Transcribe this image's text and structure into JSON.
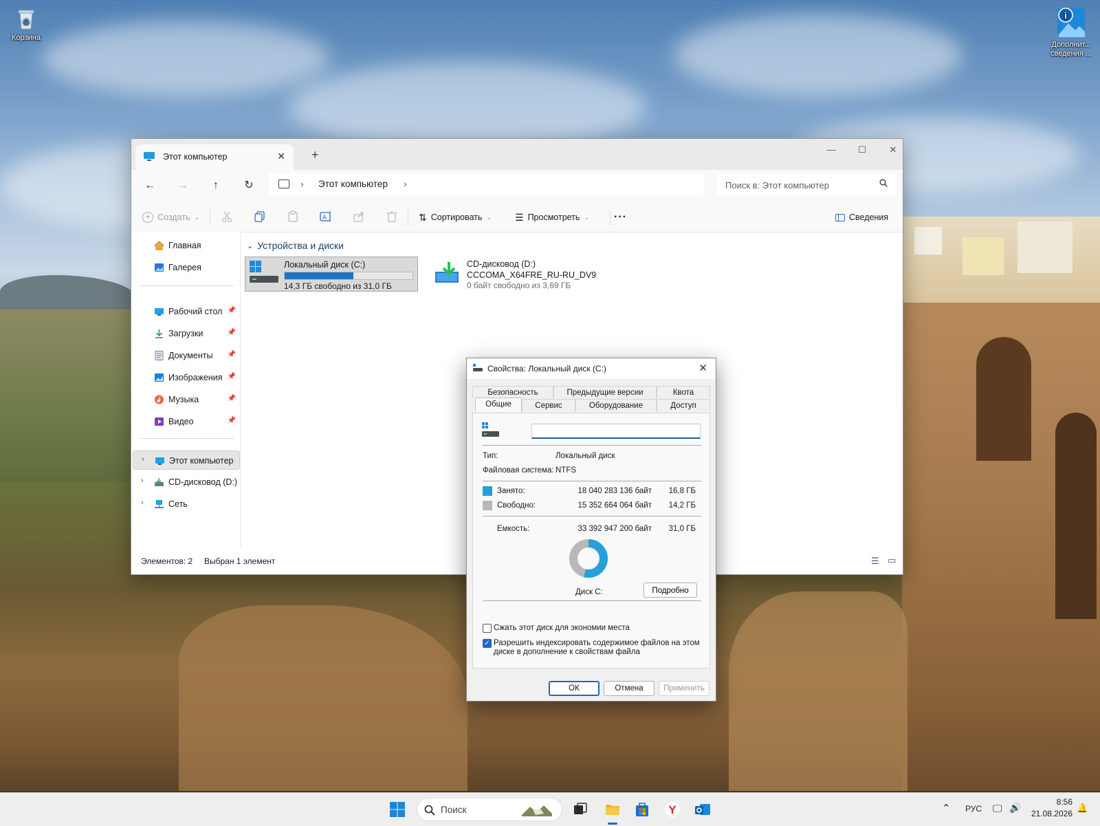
{
  "desktop": {
    "icons": [
      {
        "label": "Корзина"
      },
      {
        "label": "Дополнит... сведения ..."
      }
    ]
  },
  "explorer": {
    "tab_title": "Этот компьютер",
    "new_tab": "+",
    "breadcrumb": "Этот компьютер",
    "search_placeholder": "Поиск в: Этот компьютер",
    "commands": {
      "create": "Создать",
      "sort": "Сортировать",
      "view": "Просмотреть",
      "more": "···",
      "details": "Сведения"
    },
    "sidebar": {
      "quick": [
        {
          "label": "Главная"
        },
        {
          "label": "Галерея"
        }
      ],
      "pinned": [
        {
          "label": "Рабочий стол"
        },
        {
          "label": "Загрузки"
        },
        {
          "label": "Документы"
        },
        {
          "label": "Изображения"
        },
        {
          "label": "Музыка"
        },
        {
          "label": "Видео"
        }
      ],
      "tree": [
        {
          "label": "Этот компьютер"
        },
        {
          "label": "CD-дисковод (D:) C"
        },
        {
          "label": "Сеть"
        }
      ]
    },
    "group_header": "Устройства и диски",
    "drives": [
      {
        "name": "Локальный диск (C:)",
        "free_text": "14,3 ГБ свободно из 31,0 ГБ",
        "used_fraction": 0.54
      },
      {
        "name": "CD-дисковод (D:)",
        "volume": "CCCOMA_X64FRE_RU-RU_DV9",
        "free_text": "0 байт свободно из 3,69 ГБ"
      }
    ],
    "status": {
      "items": "Элементов: 2",
      "selected": "Выбран 1 элемент"
    }
  },
  "dialog": {
    "title": "Свойства: Локальный диск (C:)",
    "tabs_row1": [
      "Безопасность",
      "Предыдущие версии",
      "Квота"
    ],
    "tabs_row2": [
      "Общие",
      "Сервис",
      "Оборудование",
      "Доступ"
    ],
    "name_value": "",
    "type_label": "Тип:",
    "type_value": "Локальный диск",
    "fs_label": "Файловая система:",
    "fs_value": "NTFS",
    "used_label": "Занято:",
    "used_bytes": "18 040 283 136 байт",
    "used_gb": "16,8 ГБ",
    "free_label": "Свободно:",
    "free_bytes": "15 352 664 064 байт",
    "free_gb": "14,2 ГБ",
    "capacity_label": "Емкость:",
    "capacity_bytes": "33 392 947 200 байт",
    "capacity_gb": "31,0 ГБ",
    "disk_label": "Диск C:",
    "details_button": "Подробно",
    "compress_label": "Сжать этот диск для экономии места",
    "index_label_1": "Разрешить индексировать содержимое файлов на этом",
    "index_label_2": "диске в дополнение к свойствам файла",
    "ok": "ОК",
    "cancel": "Отмена",
    "apply": "Применить",
    "colors": {
      "used": "#26a0da",
      "free": "#b8b8b8"
    },
    "used_fraction": 0.54
  },
  "taskbar": {
    "search_label": "Поиск",
    "lang": "РУС",
    "time": "8:56",
    "date": "21.08.2026"
  }
}
